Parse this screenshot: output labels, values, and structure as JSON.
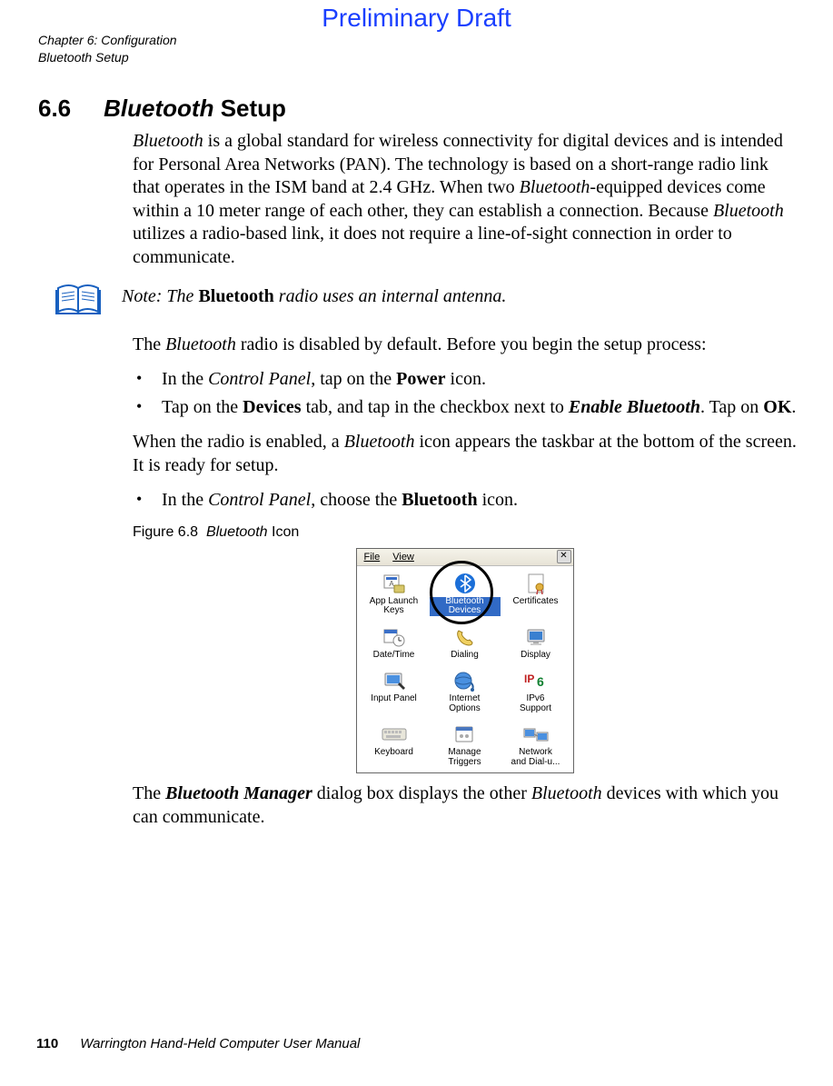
{
  "watermark": "Preliminary Draft",
  "runningHead": {
    "line1": "Chapter 6: Configuration",
    "line2": "Bluetooth Setup"
  },
  "section": {
    "number": "6.6",
    "titleItalic": "Bluetooth",
    "titleRest": " Setup"
  },
  "intro": {
    "p1_a": "Bluetooth",
    "p1_b": " is a global standard for wireless connectivity for digital devices and is intended for Personal Area Networks (PAN). The technology is based on a short-range radio link that operates in the ISM band at 2.4 GHz. When two ",
    "p1_c": "Bluetooth",
    "p1_d": "-equipped devices come within a 10 meter range of each other, they can establish a connection. Because ",
    "p1_e": "Bluetooth",
    "p1_f": " utilizes a radio-based link, it does not require a line-of-sight connection in order to communicate."
  },
  "note": {
    "prefix": "Note: The ",
    "bold": "Bluetooth",
    "suffix": " radio uses an internal antenna."
  },
  "setup": {
    "p2_a": "The ",
    "p2_b": "Bluetooth",
    "p2_c": " radio is disabled by default. Before you begin the setup process:",
    "b1_a": "In the ",
    "b1_b": "Control Panel",
    "b1_c": ", tap on the ",
    "b1_d": "Power",
    "b1_e": " icon.",
    "b2_a": "Tap on the ",
    "b2_b": "Devices",
    "b2_c": " tab, and tap in the checkbox next to ",
    "b2_d": "Enable Bluetooth",
    "b2_e": ". Tap on ",
    "b2_f": "OK",
    "b2_g": ".",
    "p3_a": "When the radio is enabled, a ",
    "p3_b": "Bluetooth",
    "p3_c": " icon appears the taskbar at the bottom of the screen. It is ready for setup.",
    "b3_a": "In the ",
    "b3_b": "Control Panel",
    "b3_c": ", choose the ",
    "b3_d": "Bluetooth",
    "b3_e": " icon."
  },
  "figure": {
    "number": "Figure 6.8",
    "titleItalic": "Bluetooth",
    "titleRest": " Icon"
  },
  "controlPanel": {
    "menu": {
      "file": "File",
      "view": "View"
    },
    "items": [
      {
        "label1": "App Launch",
        "label2": "Keys"
      },
      {
        "label1": "Bluetooth",
        "label2": "Devices"
      },
      {
        "label1": "Certificates",
        "label2": ""
      },
      {
        "label1": "Date/Time",
        "label2": ""
      },
      {
        "label1": "Dialing",
        "label2": ""
      },
      {
        "label1": "Display",
        "label2": ""
      },
      {
        "label1": "Input Panel",
        "label2": ""
      },
      {
        "label1": "Internet",
        "label2": "Options"
      },
      {
        "label1": "IPv6",
        "label2": "Support"
      },
      {
        "label1": "Keyboard",
        "label2": ""
      },
      {
        "label1": "Manage",
        "label2": "Triggers"
      },
      {
        "label1": "Network",
        "label2": "and Dial-u..."
      }
    ]
  },
  "closing": {
    "a": "The ",
    "b": "Bluetooth Manager",
    "c": " dialog box displays the other ",
    "d": "Bluetooth",
    "e": " devices with which you can communicate."
  },
  "footer": {
    "page": "110",
    "title": "Warrington Hand-Held Computer User Manual"
  }
}
